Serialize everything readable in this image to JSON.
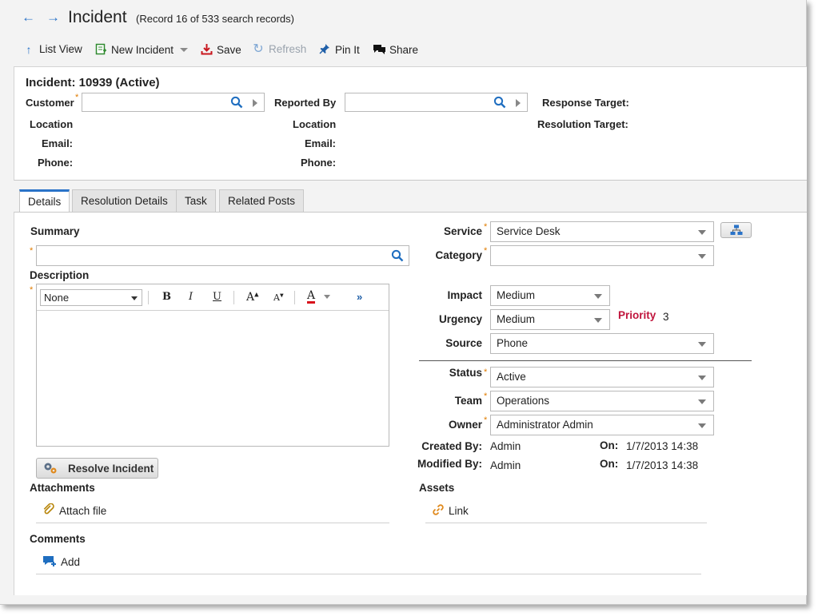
{
  "header": {
    "title": "Incident",
    "record_info": "(Record 16 of 533 search records)"
  },
  "toolbar": {
    "list_view": "List View",
    "new_incident": "New Incident",
    "save": "Save",
    "refresh": "Refresh",
    "pin_it": "Pin It",
    "share": "Share"
  },
  "incident": {
    "heading": "Incident: 10939 (Active)",
    "customer_label": "Customer",
    "reported_by_label": "Reported By",
    "response_target_label": "Response Target:",
    "resolution_target_label": "Resolution Target:",
    "location_label": "Location",
    "email_label": "Email:",
    "phone_label": "Phone:",
    "required_mark": "*"
  },
  "tabs": [
    {
      "label": "Details",
      "active": true
    },
    {
      "label": "Resolution Details",
      "active": false
    },
    {
      "label": "Task",
      "active": false
    },
    {
      "label": "Related Posts",
      "active": false
    }
  ],
  "details": {
    "summary_label": "Summary",
    "description_label": "Description",
    "editor_format_value": "None",
    "editor_more": "»",
    "resolve_button": "Resolve Incident",
    "attachments_label": "Attachments",
    "attach_file": "Attach file",
    "comments_label": "Comments",
    "add_comment": "Add",
    "service_label": "Service",
    "service_value": "Service Desk",
    "category_label": "Category",
    "category_value": "",
    "impact_label": "Impact",
    "impact_value": "Medium",
    "urgency_label": "Urgency",
    "urgency_value": "Medium",
    "priority_label": "Priority",
    "priority_value": "3",
    "source_label": "Source",
    "source_value": "Phone",
    "status_label": "Status",
    "status_value": "Active",
    "team_label": "Team",
    "team_value": "Operations",
    "owner_label": "Owner",
    "owner_value": "Administrator Admin",
    "created_by_label": "Created By:",
    "created_by_value": "Admin",
    "created_on_label": "On:",
    "created_on_value": "1/7/2013 14:38",
    "modified_by_label": "Modified By:",
    "modified_by_value": "Admin",
    "modified_on_label": "On:",
    "modified_on_value": "1/7/2013 14:38",
    "assets_label": "Assets",
    "link_label": "Link"
  },
  "colors": {
    "accent_blue": "#2a73c8",
    "priority_red": "#c0143c",
    "required_orange": "#e07b00"
  }
}
